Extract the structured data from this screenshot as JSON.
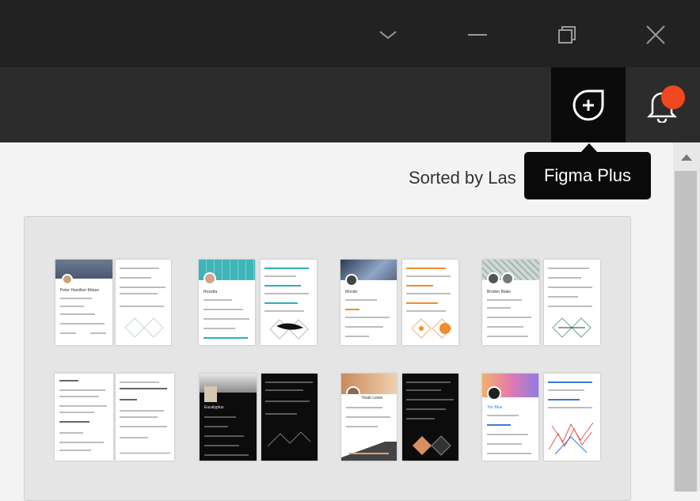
{
  "window": {
    "controls": [
      "chevron-down-icon",
      "minimize-icon",
      "restore-icon",
      "close-icon"
    ],
    "background": "#222222"
  },
  "toolbar": {
    "plus_button_icon": "plus-leaf-icon",
    "notification_icon": "bell-icon",
    "notification_badge_color": "#f24822"
  },
  "tooltip": {
    "text": "Figma Plus"
  },
  "sort": {
    "label": "Sorted by Las"
  },
  "templates": [
    {
      "row": 1,
      "name": "Peter Hamilton Mckee",
      "style": "light",
      "accent": "#5a6a80"
    },
    {
      "row": 1,
      "name": "Rosetta",
      "style": "light",
      "accent": "#2ab1b8"
    },
    {
      "row": 1,
      "name": "Mondo",
      "style": "light",
      "accent": "#f08c2c"
    },
    {
      "row": 1,
      "name": "Broden Blake",
      "style": "light",
      "accent": "#6aa898"
    },
    {
      "row": 2,
      "name": "",
      "style": "light",
      "accent": "#444444"
    },
    {
      "row": 2,
      "name": "Eucalyptus",
      "style": "dark",
      "accent": "#ffffff"
    },
    {
      "row": 2,
      "name": "Noah Lewis",
      "style": "dark",
      "accent": "#e0a070"
    },
    {
      "row": 2,
      "name": "Tori Blue",
      "style": "light",
      "accent": "#3a78d8"
    }
  ]
}
